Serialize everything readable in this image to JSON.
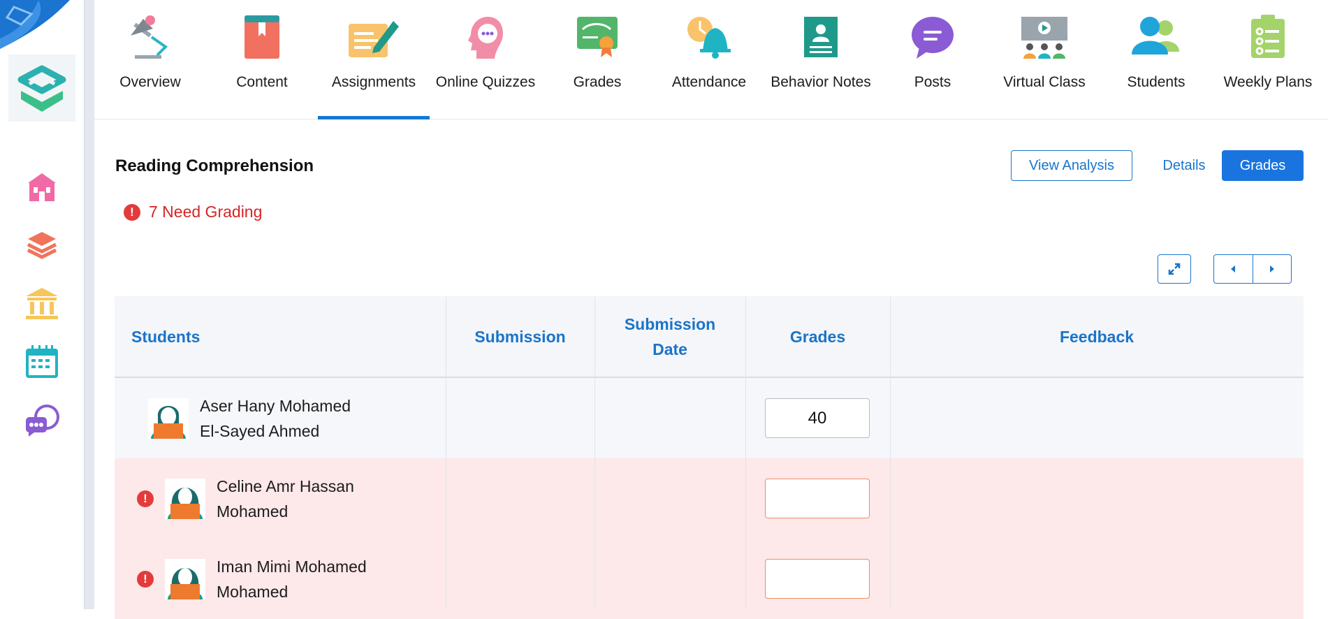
{
  "tabs": [
    {
      "label": "Overview",
      "icon": "lamp-icon",
      "active": false
    },
    {
      "label": "Content",
      "icon": "book-icon",
      "active": false
    },
    {
      "label": "Assignments",
      "icon": "pen-paper-icon",
      "active": true
    },
    {
      "label": "Online Quizzes",
      "icon": "head-chat-icon",
      "active": false
    },
    {
      "label": "Grades",
      "icon": "certificate-icon",
      "active": false
    },
    {
      "label": "Attendance",
      "icon": "bell-clock-icon",
      "active": false
    },
    {
      "label": "Behavior Notes",
      "icon": "id-card-icon",
      "active": false
    },
    {
      "label": "Posts",
      "icon": "speech-bubble-icon",
      "active": false
    },
    {
      "label": "Virtual Class",
      "icon": "presentation-icon",
      "active": false
    },
    {
      "label": "Students",
      "icon": "users-icon",
      "active": false
    },
    {
      "label": "Weekly Plans",
      "icon": "clipboard-list-icon",
      "active": false
    }
  ],
  "sidebar": {
    "items": [
      {
        "icon": "school-icon",
        "color": "#f06aa5"
      },
      {
        "icon": "layers-icon",
        "color": "#f0745a"
      },
      {
        "icon": "institution-icon",
        "color": "#f6c65a"
      },
      {
        "icon": "calendar-icon",
        "color": "#1fb4c4"
      },
      {
        "icon": "chat-bubbles-icon",
        "color": "#8a5bd4"
      }
    ]
  },
  "page": {
    "title": "Reading Comprehension",
    "need_grading": "7 Need Grading",
    "view_analysis": "View Analysis",
    "details": "Details",
    "grades": "Grades"
  },
  "table": {
    "headers": {
      "students": "Students",
      "submission": "Submission",
      "submission_date": "Submission Date",
      "grades": "Grades",
      "feedback": "Feedback"
    },
    "rows": [
      {
        "name": "Aser Hany Mohamed El-Sayed Ahmed",
        "grade": "40",
        "needs_grading": false
      },
      {
        "name": "Celine Amr Hassan Mohamed",
        "grade": "",
        "needs_grading": true
      },
      {
        "name": "Iman Mimi Mohamed Mohamed",
        "grade": "",
        "needs_grading": true
      }
    ]
  },
  "colors": {
    "accent": "#1a74c9",
    "primary_button": "#1a74e0",
    "alert": "#d42626",
    "need_row_bg": "#fde8ea"
  }
}
